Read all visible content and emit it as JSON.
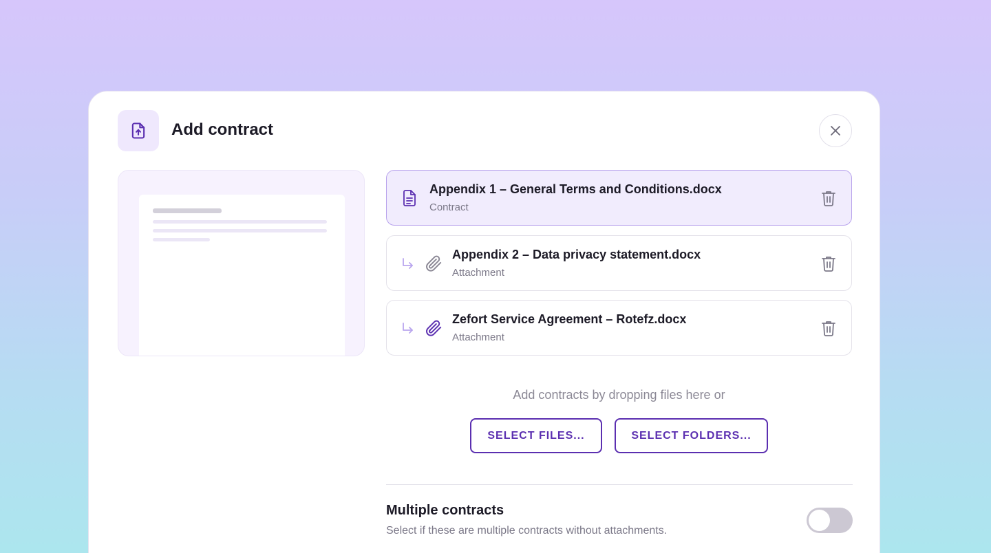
{
  "modal": {
    "title": "Add contract",
    "header_icon": "file-upload-icon",
    "close_icon": "close-icon"
  },
  "files": [
    {
      "name": "Appendix 1 – General Terms and Conditions.docx",
      "type": "Contract",
      "icon": "document-icon",
      "selected": true
    },
    {
      "name": "Appendix 2 – Data privacy statement.docx",
      "type": "Attachment",
      "icon": "paperclip-icon",
      "selected": false
    },
    {
      "name": "Zefort Service Agreement – Rotefz.docx",
      "type": "Attachment",
      "icon": "paperclip-icon",
      "selected": false
    }
  ],
  "drop": {
    "text": "Add contracts by dropping files here or",
    "select_files_label": "SELECT FILES...",
    "select_folders_label": "SELECT FOLDERS..."
  },
  "multiple_contracts": {
    "title": "Multiple contracts",
    "description": "Select if these are multiple contracts without attachments.",
    "enabled": false
  },
  "colors": {
    "accent": "#5b2fb0",
    "selected_card_bg": "#f1ecfd",
    "selected_card_border": "#b8a3ec"
  }
}
